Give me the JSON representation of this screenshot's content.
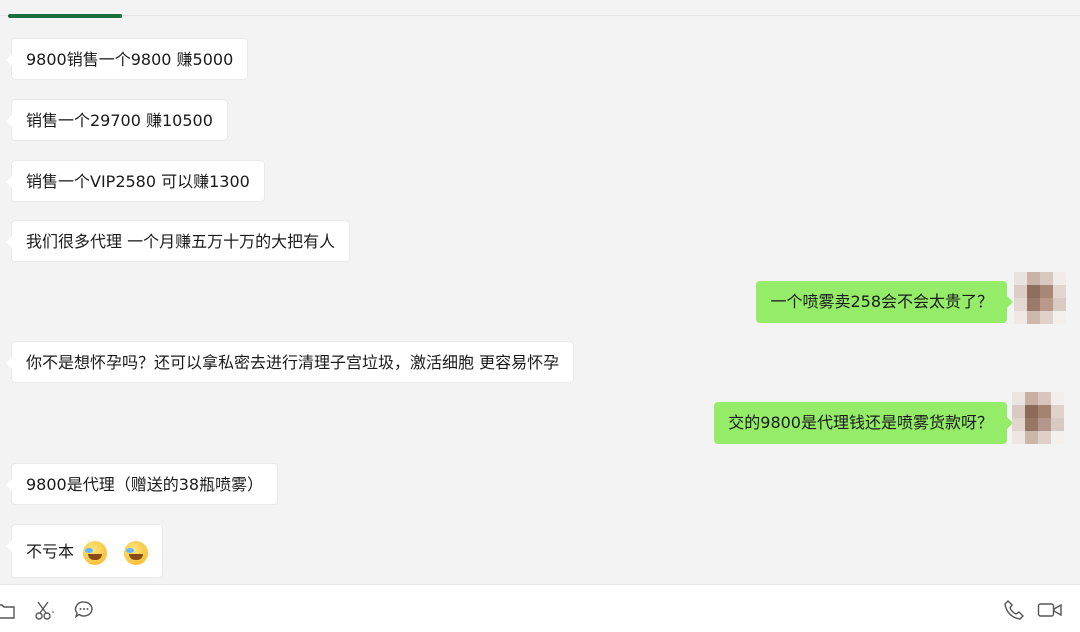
{
  "messages": [
    {
      "side": "left",
      "text": "9800销售一个9800 赚5000"
    },
    {
      "side": "left",
      "text": "销售一个29700 赚10500"
    },
    {
      "side": "left",
      "text": "销售一个VIP2580 可以赚1300"
    },
    {
      "side": "left",
      "text": "我们很多代理 一个月赚五万十万的大把有人"
    },
    {
      "side": "right",
      "text": "一个喷雾卖258会不会太贵了？"
    },
    {
      "side": "left",
      "text": "你不是想怀孕吗？还可以拿私密去进行清理子宫垃圾，激活细胞 更容易怀孕"
    },
    {
      "side": "right",
      "text": "交的9800是代理钱还是喷雾货款呀？"
    },
    {
      "side": "left",
      "text": "9800是代理（赠送的38瓶喷雾）"
    },
    {
      "side": "left",
      "text": "不亏本",
      "emojis": [
        "laughing-crying-emoji",
        "laughing-crying-emoji"
      ]
    }
  ],
  "colors": {
    "background": "#f3f3f3",
    "bubble_left": "#ffffff",
    "bubble_right": "#95ec69",
    "accent_tab": "#1c6e3a"
  },
  "toolbar": {
    "left_icons": [
      "folder-icon",
      "scissors-icon",
      "chat-bubble-icon"
    ],
    "right_icons": [
      "phone-icon",
      "video-call-icon"
    ]
  }
}
